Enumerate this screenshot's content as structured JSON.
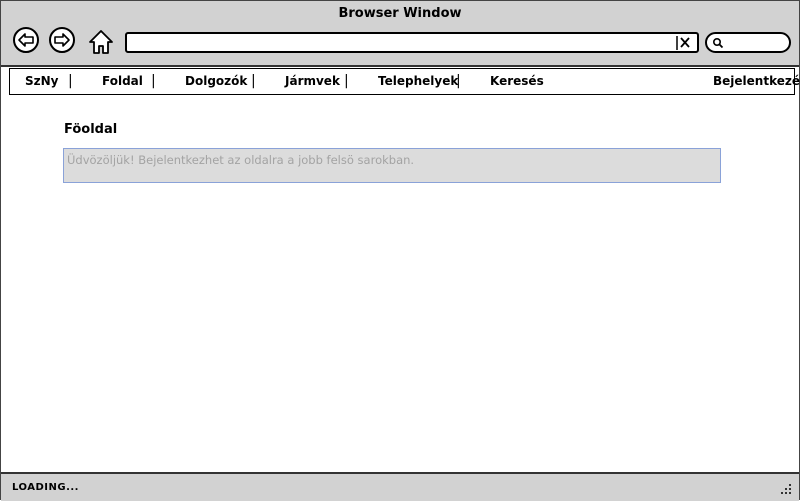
{
  "window": {
    "title": "Browser Window"
  },
  "nav": {
    "items": [
      {
        "label": "SzNy"
      },
      {
        "label": "Foldal"
      },
      {
        "label": "Dolgozók"
      },
      {
        "label": "Jármvek"
      },
      {
        "label": "Telephelyek"
      },
      {
        "label": "Keresés"
      }
    ],
    "separator": "|",
    "login": "Bejelentkezés"
  },
  "main": {
    "title": "Föoldal",
    "welcome_text": "Üdvözöljük! Bejelentkezhet az oldalra a jobb felsö sarokban."
  },
  "status": {
    "text": "LOADING..."
  },
  "icons": {
    "back": "arrow-left-icon",
    "forward": "arrow-right-icon",
    "home": "home-icon",
    "clear": "close-icon",
    "search": "search-icon",
    "resize": "resize-grip-icon"
  }
}
